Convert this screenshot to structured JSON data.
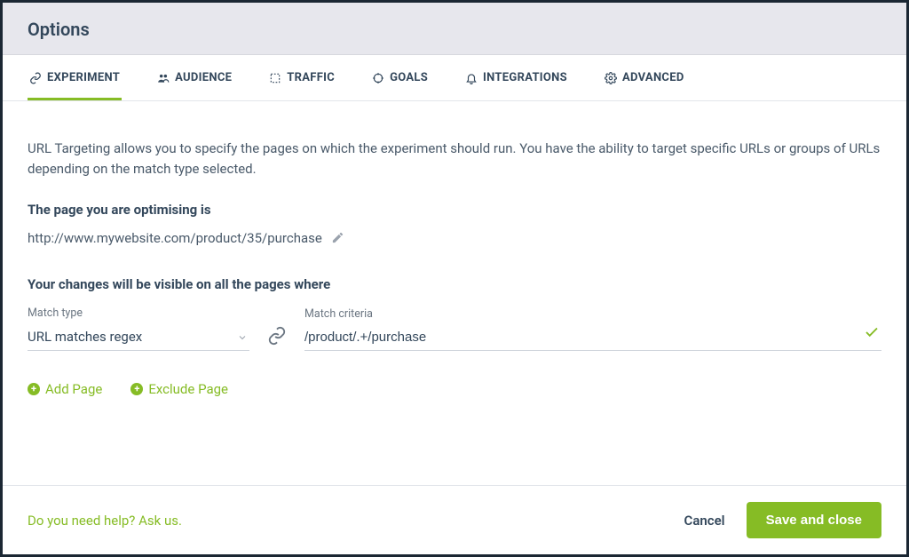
{
  "header": {
    "title": "Options"
  },
  "tabs": [
    {
      "label": "EXPERIMENT",
      "icon": "link-icon",
      "active": true
    },
    {
      "label": "AUDIENCE",
      "icon": "people-icon",
      "active": false
    },
    {
      "label": "TRAFFIC",
      "icon": "target-icon",
      "active": false
    },
    {
      "label": "GOALS",
      "icon": "crosshair-icon",
      "active": false
    },
    {
      "label": "INTEGRATIONS",
      "icon": "bell-icon",
      "active": false
    },
    {
      "label": "ADVANCED",
      "icon": "gear-icon",
      "active": false
    }
  ],
  "experiment": {
    "intro": "URL Targeting allows you to specify the pages on which the experiment should run. You have the ability to target specific URLs or groups of URLs depending on the match type selected.",
    "optimising_label": "The page you are optimising is",
    "optimising_url": "http://www.mywebsite.com/product/35/purchase",
    "visible_label": "Your changes will be visible on all the pages where",
    "match_type_label": "Match type",
    "match_type_value": "URL matches regex",
    "match_criteria_label": "Match criteria",
    "match_criteria_value": "/product/.+/purchase",
    "add_page_label": "Add Page",
    "exclude_page_label": "Exclude Page"
  },
  "footer": {
    "help": "Do you need help? Ask us.",
    "cancel": "Cancel",
    "save": "Save and close"
  },
  "colors": {
    "accent": "#86bc25",
    "text": "#33475b"
  }
}
